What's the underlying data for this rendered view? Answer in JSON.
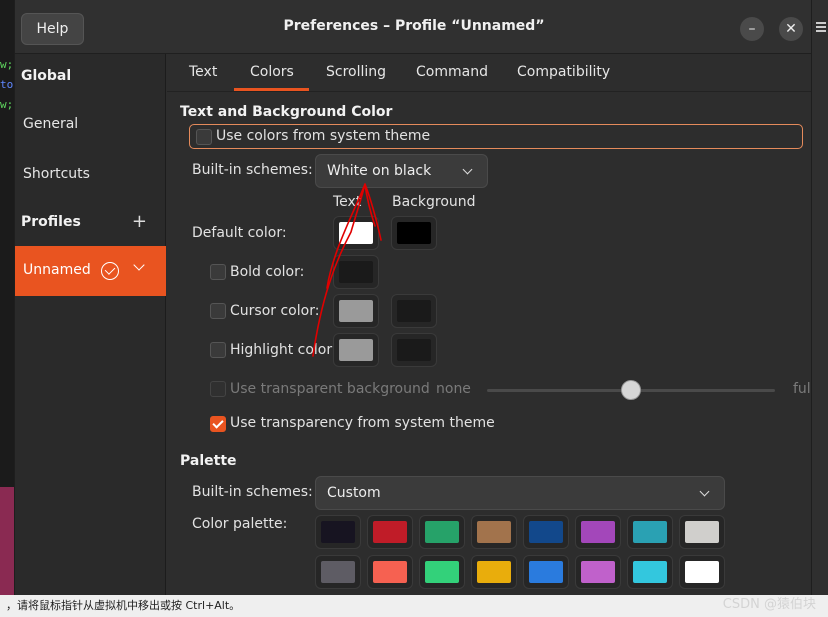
{
  "window": {
    "help_label": "Help",
    "title": "Preferences – Profile “Unnamed”",
    "minimize_label": "–",
    "close_label": "✕"
  },
  "terminal_bg": {
    "lines": [
      "w;",
      "to",
      "w;"
    ]
  },
  "sidebar": {
    "global_label": "Global",
    "general_label": "General",
    "shortcuts_label": "Shortcuts",
    "profiles_label": "Profiles",
    "add_label": "+",
    "profile_name": "Unnamed"
  },
  "tabs": [
    "Text",
    "Colors",
    "Scrolling",
    "Command",
    "Compatibility"
  ],
  "text_bg": {
    "section_title": "Text and Background Color",
    "use_system_colors": "Use colors from system theme",
    "use_system_colors_checked": false,
    "builtin_label": "Built-in schemes:",
    "builtin_value": "White on black",
    "col_text": "Text",
    "col_background": "Background",
    "default_color_label": "Default color:",
    "bold_color_label": "Bold color:",
    "cursor_color_label": "Cursor color:",
    "highlight_color_label": "Highlight color:",
    "default_text_color": "#ffffff",
    "default_bg_color": "#000000",
    "bold_color": "#1a1a1a",
    "cursor_text_color": "#9a9a9a",
    "cursor_bg_color": "#1a1a1a",
    "highlight_text_color": "#9a9a9a",
    "highlight_bg_color": "#1a1a1a",
    "transparent_bg_label": "Use transparent background",
    "transparent_none": "none",
    "transparent_full": "full",
    "transparency_level": 0.5,
    "system_transparency_label": "Use transparency from system theme",
    "system_transparency_checked": true
  },
  "palette": {
    "section_title": "Palette",
    "builtin_label": "Built-in schemes:",
    "builtin_value": "Custom",
    "color_palette_label": "Color palette:",
    "row1": [
      "#171421",
      "#c01c28",
      "#26a269",
      "#a2734c",
      "#12488b",
      "#a347ba",
      "#2aa1b3",
      "#d0cfcc"
    ],
    "row2": [
      "#5e5c64",
      "#f66151",
      "#33d17a",
      "#e9ad0c",
      "#2a7bde",
      "#c061cb",
      "#33c7de",
      "#ffffff"
    ]
  },
  "statusbar": {
    "text": "，请将鼠标指针从虚拟机中移出或按 Ctrl+Alt。"
  },
  "watermark": {
    "text": "CSDN @猿伯块"
  },
  "colors": {
    "accent": "#e95420",
    "annotation": "#e00000"
  }
}
